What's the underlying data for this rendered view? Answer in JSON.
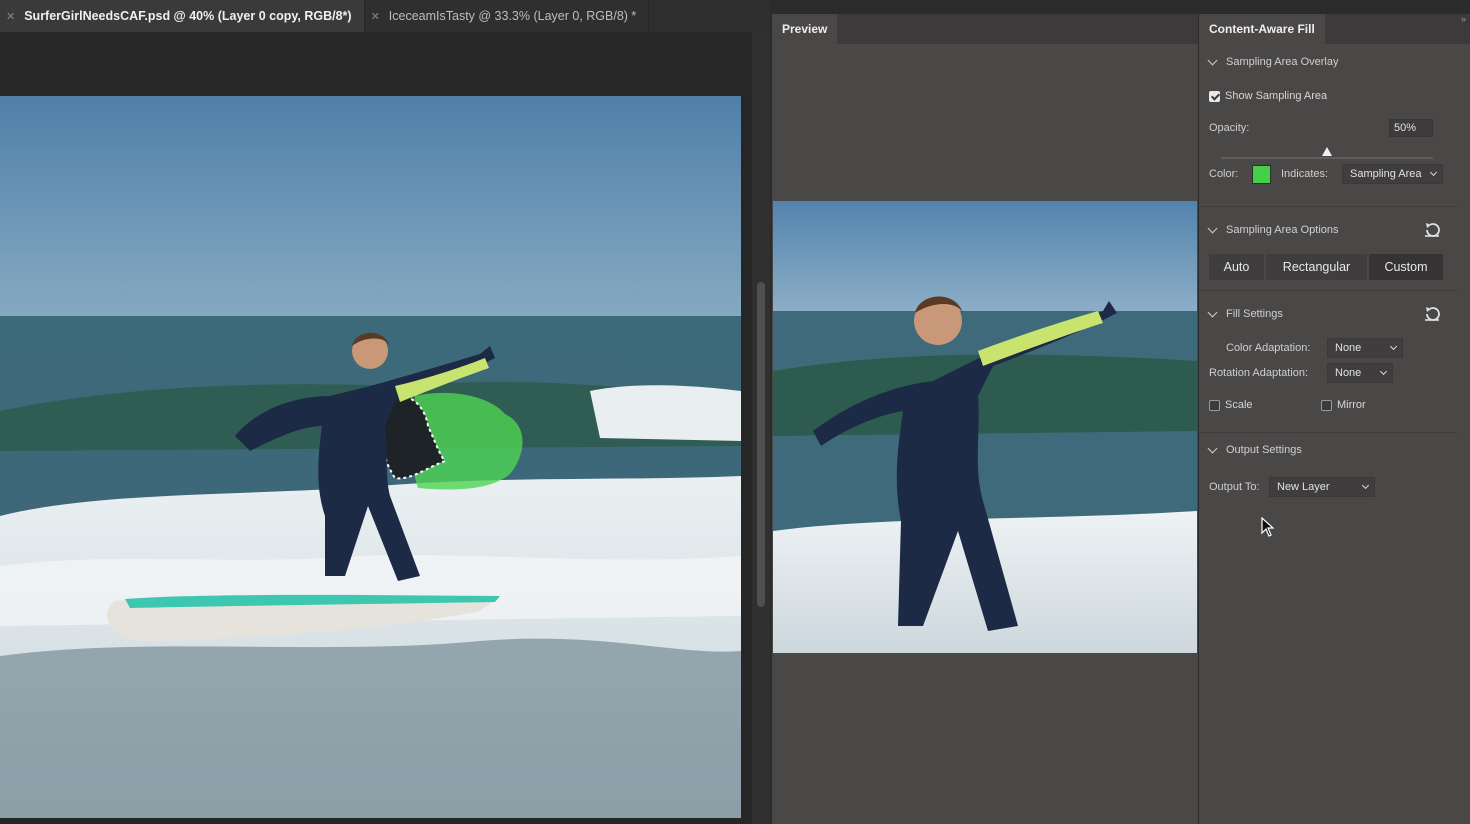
{
  "tabs": [
    {
      "label": "SurferGirlNeedsCAF.psd @ 40% (Layer 0 copy, RGB/8*)",
      "active": true
    },
    {
      "label": "IceceamIsTasty @ 33.3% (Layer 0, RGB/8) *",
      "active": false
    }
  ],
  "preview": {
    "tab_label": "Preview"
  },
  "caf": {
    "tab_label": "Content-Aware Fill",
    "overlay": {
      "header": "Sampling Area Overlay",
      "show_label": "Show Sampling Area",
      "show_checked": true,
      "opacity_label": "Opacity:",
      "opacity_value": "50%",
      "opacity_level": 0.5,
      "color_label": "Color:",
      "color_value": "#43d046",
      "indicates_label": "Indicates:",
      "indicates_value": "Sampling Area"
    },
    "options": {
      "header": "Sampling Area Options",
      "buttons": [
        "Auto",
        "Rectangular",
        "Custom"
      ],
      "selected": "Custom"
    },
    "fill": {
      "header": "Fill Settings",
      "color_adaptation_label": "Color Adaptation:",
      "color_adaptation_value": "None",
      "rotation_adaptation_label": "Rotation Adaptation:",
      "rotation_adaptation_value": "None",
      "scale_label": "Scale",
      "scale_checked": false,
      "mirror_label": "Mirror",
      "mirror_checked": false
    },
    "output": {
      "header": "Output Settings",
      "output_to_label": "Output To:",
      "output_to_value": "New Layer"
    }
  },
  "icons": [
    "close-icon",
    "chevron-down-icon",
    "reset-icon",
    "checkbox-icon",
    "caret-down-icon",
    "mouse-cursor-icon",
    "panel-menu-icon"
  ]
}
